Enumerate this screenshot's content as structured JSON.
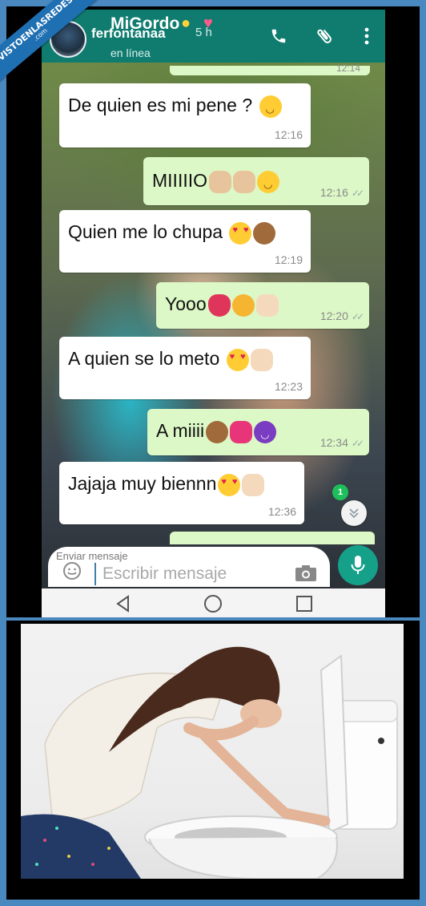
{
  "watermark": {
    "line1": "VISTOENLASREDES",
    "line2": ".com"
  },
  "header": {
    "contact_name": "MiGordo",
    "overlay_name": "ferfontanaa",
    "overlay_time": "5 h",
    "status": "en línea",
    "brand_color": "#0f7c6f"
  },
  "icons": {
    "call": "phone-icon",
    "attach": "paperclip-icon",
    "menu": "more-vert-icon"
  },
  "messages": [
    {
      "direction": "in",
      "text": "De quien es mi pene ?",
      "emojis": [
        "smiling-face"
      ],
      "time": "12:16"
    },
    {
      "direction": "out",
      "text": "MIIIIIO",
      "emojis": [
        "raising-hand",
        "raising-hand",
        "smirking-face"
      ],
      "time": "12:16",
      "ticks": "✓✓"
    },
    {
      "direction": "in",
      "text": "Quien me lo chupa",
      "emojis": [
        "heart-eyes",
        "see-no-evil-monkey"
      ],
      "time": "12:19"
    },
    {
      "direction": "out",
      "text": "Yooo",
      "emojis": [
        "tongue",
        "heart-eyes-cat",
        "clapping-hands"
      ],
      "time": "12:20",
      "ticks": "✓✓"
    },
    {
      "direction": "in",
      "text": "A quien se lo meto",
      "emojis": [
        "heart-eyes",
        "clapping-hands"
      ],
      "time": "12:23"
    },
    {
      "direction": "out",
      "text": "A miiii",
      "emojis": [
        "see-no-evil-monkey",
        "heart-with-arrow",
        "smiling-devil"
      ],
      "time": "12:34",
      "ticks": "✓✓"
    },
    {
      "direction": "in",
      "text": "Jajaja muy biennn",
      "emojis": [
        "heart-eyes",
        "clapping-hands"
      ],
      "time": "12:36"
    }
  ],
  "partial_time": "12:14",
  "scroll": {
    "unread_count": "1",
    "icon": "chevron-double-down-icon"
  },
  "composer": {
    "overlay_label": "Enviar mensaje",
    "placeholder": "Escribir mensaje",
    "emoji_icon": "smiley-icon",
    "camera_icon": "camera-icon",
    "mic_icon": "microphone-icon"
  },
  "navbar": {
    "back": "back-triangle-icon",
    "home": "home-circle-icon",
    "recents": "recents-square-icon"
  },
  "photo": {
    "subject": "woman-leaning-over-toilet"
  }
}
